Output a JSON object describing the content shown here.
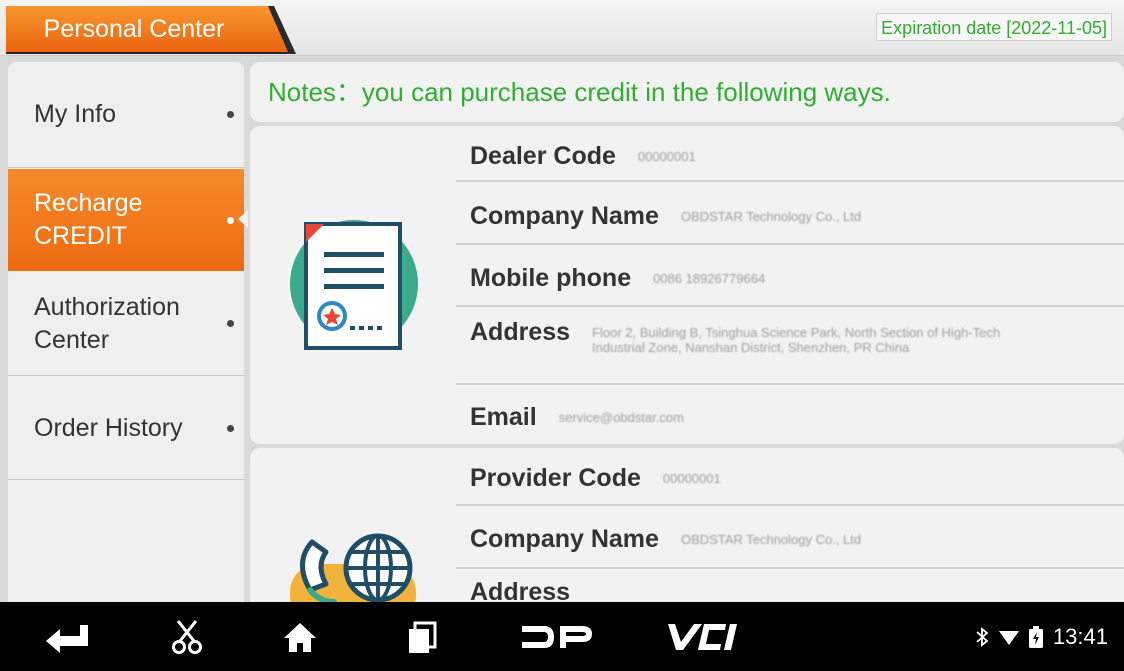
{
  "header": {
    "tab_label": "Personal Center",
    "expiration": "Expiration date [2022-11-05]"
  },
  "sidebar": {
    "items": [
      {
        "label": "My Info",
        "active": false
      },
      {
        "label": "Recharge CREDIT",
        "active": true
      },
      {
        "label": "Authorization Center",
        "active": false
      },
      {
        "label": "Order History",
        "active": false
      }
    ]
  },
  "main": {
    "notes": "Notes：you can purchase credit in the following ways.",
    "dealer_card": {
      "fields": [
        {
          "key": "Dealer Code",
          "value": "00000001"
        },
        {
          "key": "Company Name",
          "value": "OBDSTAR Technology Co., Ltd"
        },
        {
          "key": "Mobile phone",
          "value": "0086 18926779664"
        },
        {
          "key": "Address",
          "value": "Floor 2, Building B, Tsinghua Science Park, North Section of High-Tech Industrial Zone, Nanshan District, Shenzhen, PR China"
        },
        {
          "key": "Email",
          "value": "service@obdstar.com"
        }
      ]
    },
    "provider_card": {
      "fields": [
        {
          "key": "Provider Code",
          "value": "00000001"
        },
        {
          "key": "Company Name",
          "value": "OBDSTAR Technology Co., Ltd"
        },
        {
          "key": "Address",
          "value": ""
        }
      ]
    }
  },
  "navbar": {
    "icons": [
      "back-icon",
      "scissors-icon",
      "home-icon",
      "recent-apps-icon",
      "dp-icon",
      "vci-icon"
    ],
    "dp_label": "DP",
    "vci_label": "VCI",
    "time": "13:41"
  },
  "colors": {
    "accent_orange": "#f07a1c",
    "notes_green": "#2fae2f",
    "panel_bg": "#f2f2f2"
  }
}
